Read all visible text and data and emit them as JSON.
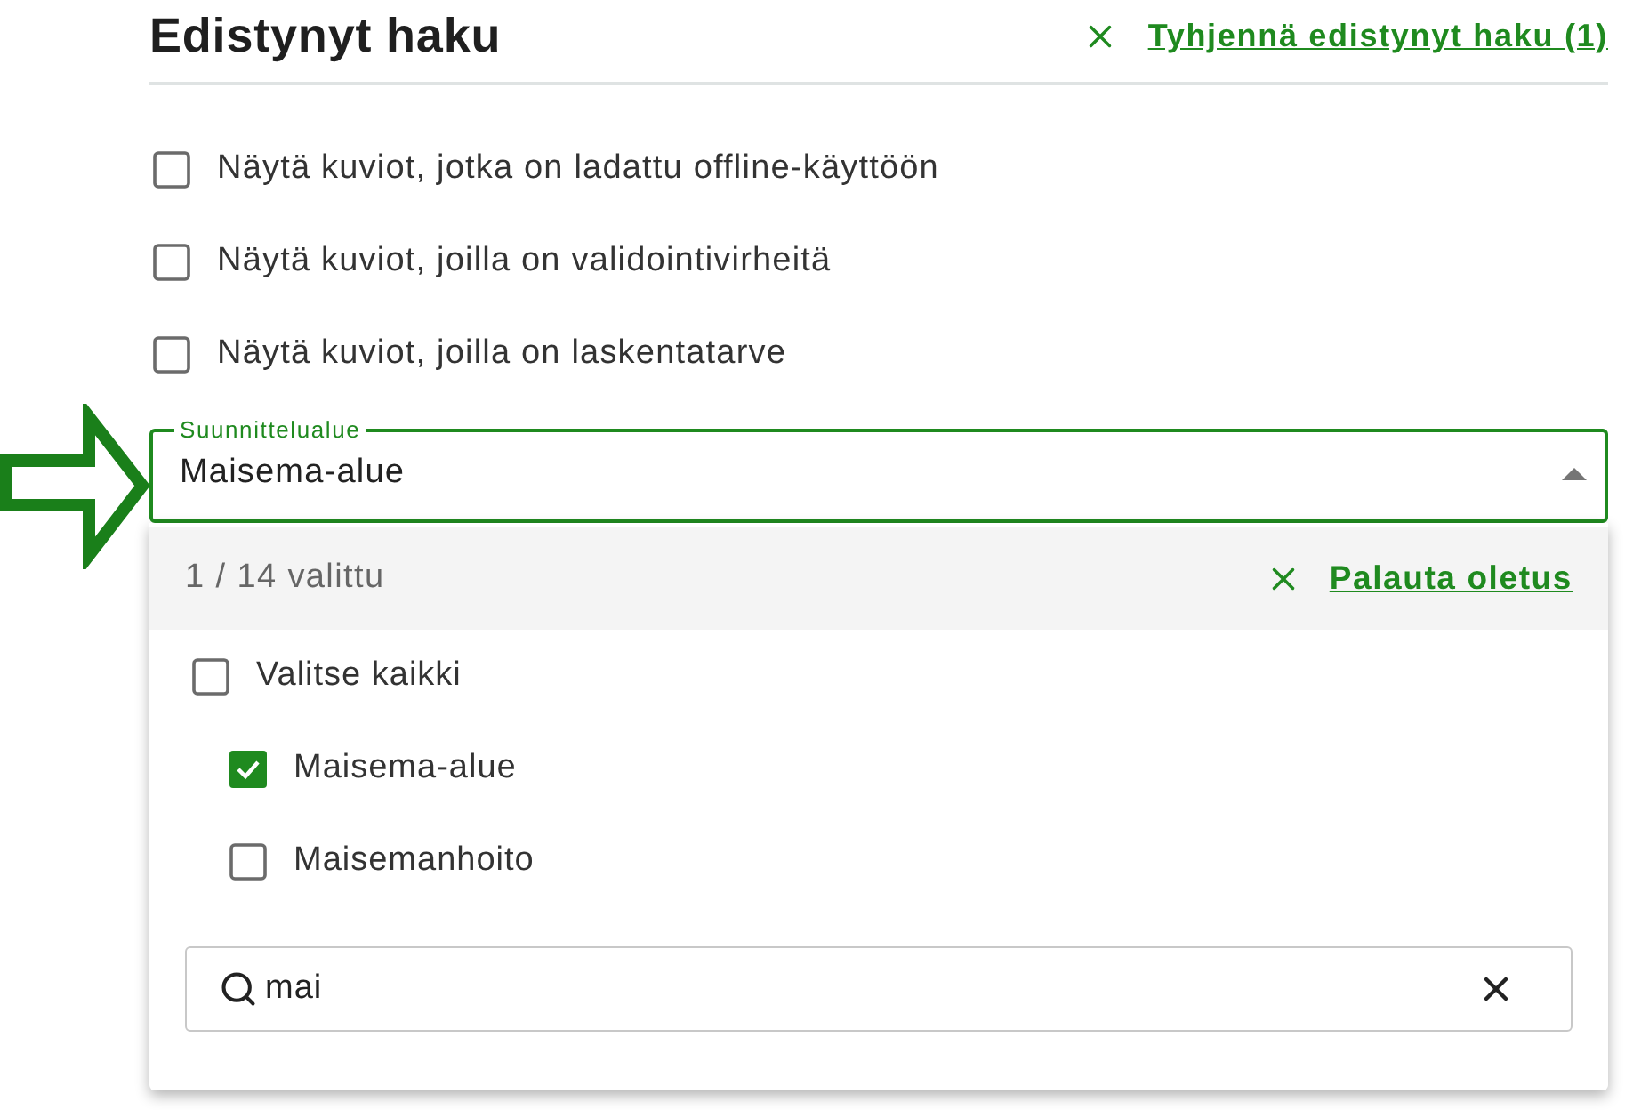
{
  "header": {
    "title": "Edistynyt haku",
    "clear_link": "Tyhjennä edistynyt haku (1)"
  },
  "filters": [
    {
      "label": "Näytä kuviot, jotka on ladattu offline-käyttöön",
      "checked": false
    },
    {
      "label": "Näytä kuviot, joilla on validointivirheitä",
      "checked": false
    },
    {
      "label": "Näytä kuviot, joilla on laskentatarve",
      "checked": false
    }
  ],
  "select": {
    "label": "Suunnittelualue",
    "value": "Maisema-alue",
    "expanded": true
  },
  "dropdown": {
    "count": "1 / 14 valittu",
    "reset_link": "Palauta oletus",
    "select_all": {
      "label": "Valitse kaikki",
      "checked": false
    },
    "options": [
      {
        "label": "Maisema-alue",
        "checked": true
      },
      {
        "label": "Maisemanhoito",
        "checked": false
      }
    ],
    "search": {
      "value": "mai"
    }
  }
}
